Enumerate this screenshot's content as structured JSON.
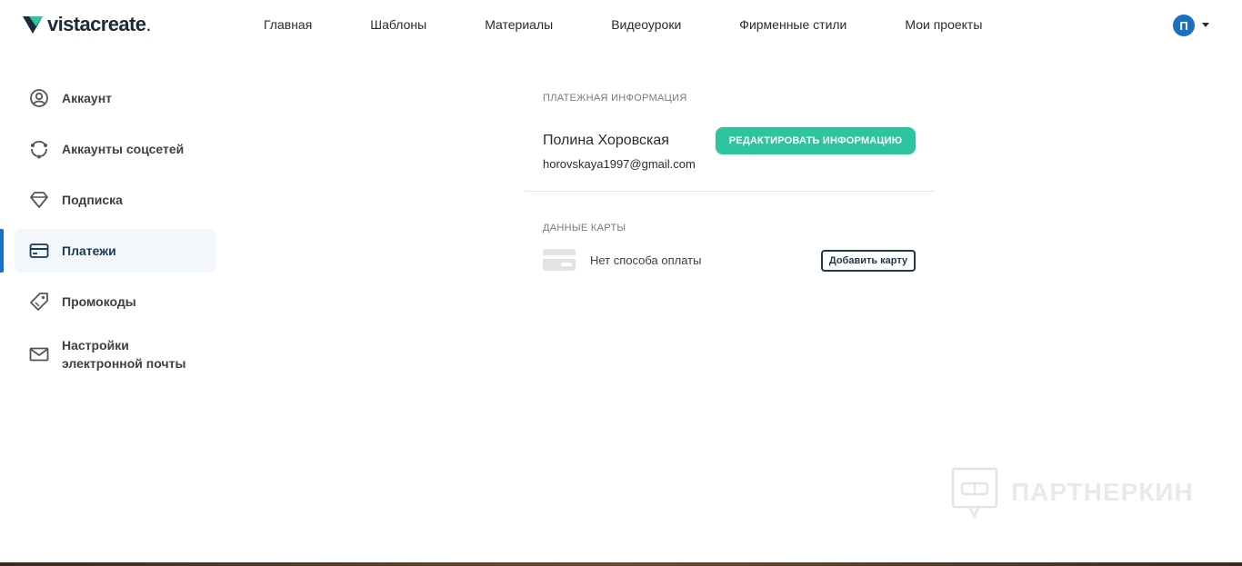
{
  "header": {
    "logo_text": "vistacreate",
    "logo_dot": ".",
    "nav": [
      "Главная",
      "Шаблоны",
      "Материалы",
      "Видеоуроки",
      "Фирменные стили",
      "Мои проекты"
    ],
    "avatar_letter": "П"
  },
  "sidebar": {
    "items": [
      {
        "label": "Аккаунт",
        "icon": "user-circle-icon"
      },
      {
        "label": "Аккаунты соцсетей",
        "icon": "share-cycle-icon"
      },
      {
        "label": "Подписка",
        "icon": "diamond-icon"
      },
      {
        "label": "Платежи",
        "icon": "credit-card-icon"
      },
      {
        "label": "Промокоды",
        "icon": "tag-icon"
      },
      {
        "label": "Настройки электронной почты",
        "icon": "mail-icon"
      }
    ],
    "active_index": 3
  },
  "payment_info": {
    "section_title": "ПЛАТЕЖНАЯ ИНФОРМАЦИЯ",
    "name": "Полина Хоровская",
    "email": "horovskaya1997@gmail.com",
    "edit_button": "РЕДАКТИРОВАТЬ ИНФОРМАЦИЮ"
  },
  "card_data": {
    "section_title": "ДАННЫЕ КАРТЫ",
    "no_method": "Нет способа оплаты",
    "add_button": "Добавить карту"
  },
  "watermark": {
    "text": "ПАРТНЕРКИН"
  },
  "colors": {
    "accent": "#1a6fc0",
    "green_button": "#2ec4a0",
    "dark_button_border": "#1a3a52"
  }
}
